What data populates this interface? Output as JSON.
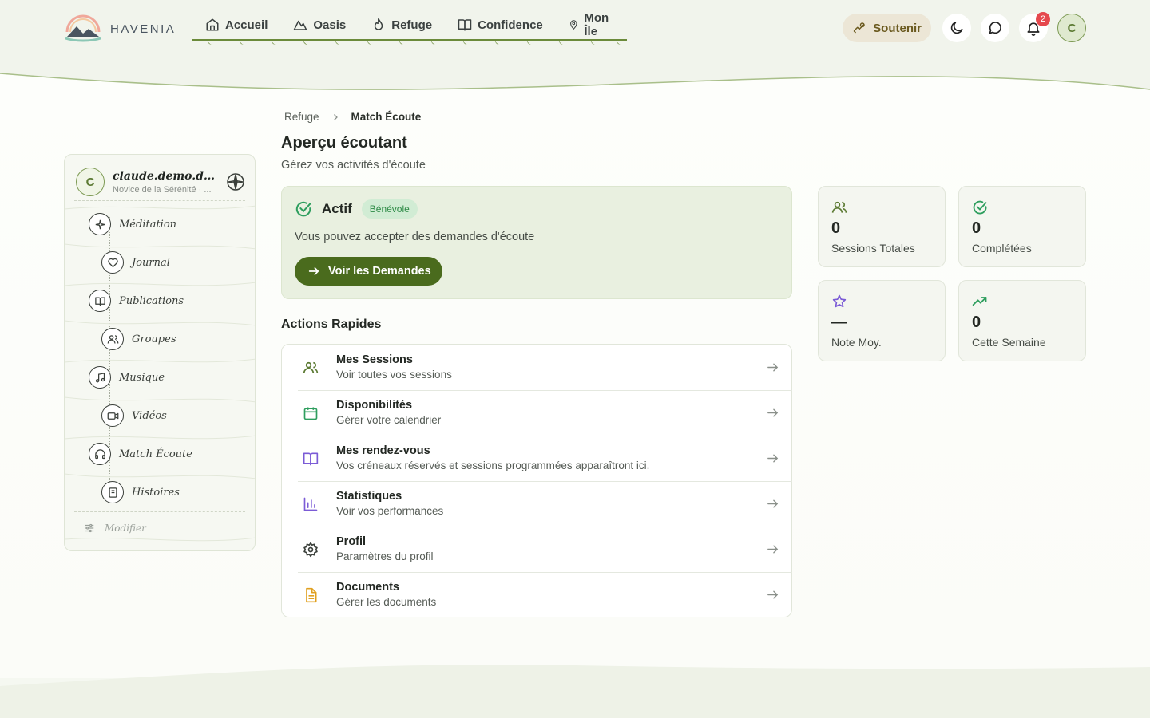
{
  "brand": {
    "name": "HAVENIA"
  },
  "nav": {
    "items": [
      {
        "label": "Accueil",
        "icon": "home-icon"
      },
      {
        "label": "Oasis",
        "icon": "mountain-icon"
      },
      {
        "label": "Refuge",
        "icon": "flame-icon"
      },
      {
        "label": "Confidence",
        "icon": "book-open-icon"
      },
      {
        "label": "Mon Île",
        "icon": "map-pin-icon"
      }
    ]
  },
  "header": {
    "support_label": "Soutenir",
    "notifications_count": "2",
    "avatar_initial": "C"
  },
  "sidebar": {
    "user_initial": "C",
    "user_name": "claude.demo.des...",
    "user_level": "Novice de la Sérénité · ...",
    "items": [
      {
        "label": "Méditation",
        "icon": "sparkles-icon"
      },
      {
        "label": "Journal",
        "icon": "heart-icon"
      },
      {
        "label": "Publications",
        "icon": "book-icon"
      },
      {
        "label": "Groupes",
        "icon": "users-icon"
      },
      {
        "label": "Musique",
        "icon": "music-icon"
      },
      {
        "label": "Vidéos",
        "icon": "video-icon"
      },
      {
        "label": "Match Écoute",
        "icon": "headphones-icon"
      },
      {
        "label": "Histoires",
        "icon": "notebook-icon"
      }
    ],
    "modify_label": "Modifier"
  },
  "breadcrumb": {
    "parent": "Refuge",
    "current": "Match Écoute"
  },
  "page": {
    "title": "Aperçu écoutant",
    "subtitle": "Gérez vos activités d'écoute"
  },
  "status": {
    "label": "Actif",
    "pill": "Bénévole",
    "text": "Vous pouvez accepter des demandes d'écoute",
    "button": "Voir les Demandes"
  },
  "quick_actions": {
    "title": "Actions Rapides",
    "items": [
      {
        "title": "Mes Sessions",
        "desc": "Voir toutes vos sessions",
        "icon": "users-icon",
        "color": "#5c7a33"
      },
      {
        "title": "Disponibilités",
        "desc": "Gérer votre calendrier",
        "icon": "calendar-icon",
        "color": "#2e9e5e"
      },
      {
        "title": "Mes rendez-vous",
        "desc": "Vos créneaux réservés et sessions programmées apparaîtront ici.",
        "icon": "book-open-icon",
        "color": "#7b5bd6"
      },
      {
        "title": "Statistiques",
        "desc": "Voir vos performances",
        "icon": "bar-chart-icon",
        "color": "#7b5bd6"
      },
      {
        "title": "Profil",
        "desc": "Paramètres du profil",
        "icon": "gear-icon",
        "color": "#3a3f3a"
      },
      {
        "title": "Documents",
        "desc": "Gérer les documents",
        "icon": "file-text-icon",
        "color": "#e0a020"
      }
    ]
  },
  "stats": [
    {
      "value": "0",
      "label": "Sessions Totales",
      "icon": "users-icon",
      "color": "#5c7a33"
    },
    {
      "value": "0",
      "label": "Complétées",
      "icon": "check-circle-icon",
      "color": "#2e9e5e"
    },
    {
      "value": "—",
      "label": "Note Moy.",
      "icon": "star-icon",
      "color": "#7b5bd6"
    },
    {
      "value": "0",
      "label": "Cette Semaine",
      "icon": "trending-up-icon",
      "color": "#2e9e5e"
    }
  ]
}
